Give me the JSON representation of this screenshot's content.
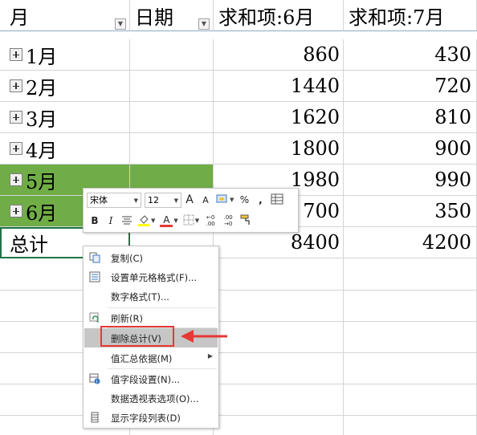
{
  "pivot": {
    "headers": {
      "month": "月",
      "date": "日期",
      "sum_jun": "求和项:6月",
      "sum_jul": "求和项:7月"
    },
    "rows": [
      {
        "month": "1月",
        "jun": "860",
        "jul": "430"
      },
      {
        "month": "2月",
        "jun": "1440",
        "jul": "720"
      },
      {
        "month": "3月",
        "jun": "1620",
        "jul": "810"
      },
      {
        "month": "4月",
        "jun": "1800",
        "jul": "900"
      },
      {
        "month": "5月",
        "jun": "1980",
        "jul": "990"
      },
      {
        "month": "6月",
        "jun": "700",
        "jul": "350"
      }
    ],
    "total": {
      "label": "总计",
      "jun": "8400",
      "jul": "4200"
    }
  },
  "mini_toolbar": {
    "font_name": "宋体",
    "font_size": "12",
    "grow_font": "A",
    "shrink_font": "A",
    "percent": "%",
    "comma": ",",
    "bold": "B",
    "italic": "I",
    "font_color_letter": "A",
    "decimal_inc": "←0 .00",
    "decimal_dec": ".00 →0"
  },
  "context_menu": {
    "items": [
      {
        "label": "复制(C)",
        "icon": "copy-icon"
      },
      {
        "label": "设置单元格格式(F)...",
        "icon": "format-cells-icon"
      },
      {
        "label": "数字格式(T)...",
        "icon": ""
      },
      {
        "label": "刷新(R)",
        "icon": "refresh-icon"
      },
      {
        "label": "删除总计(V)",
        "icon": "",
        "highlighted": true
      },
      {
        "label": "值汇总依据(M)",
        "icon": "",
        "submenu": true
      },
      {
        "label": "值字段设置(N)...",
        "icon": "value-field-settings-icon"
      },
      {
        "label": "数据透视表选项(O)...",
        "icon": ""
      },
      {
        "label": "显示字段列表(D)",
        "icon": "field-list-icon"
      }
    ]
  },
  "colors": {
    "selected_row_fill": "#70ad47",
    "highlight_box": "#e53935",
    "cell_border": "#d4d4d4"
  }
}
